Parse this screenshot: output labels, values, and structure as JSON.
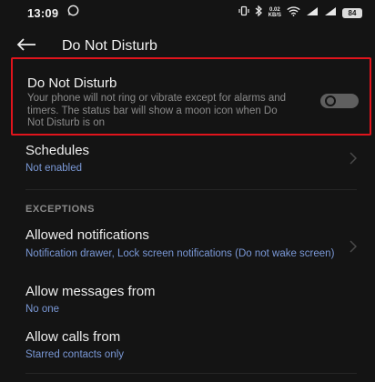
{
  "status_bar": {
    "time": "13:09",
    "speed_value": "0.02",
    "speed_unit": "KB/S",
    "battery": "84"
  },
  "app_bar": {
    "title": "Do Not Disturb"
  },
  "dnd": {
    "title": "Do Not Disturb",
    "description": "Your phone will not ring or vibrate except for alarms and timers. The status bar will show a moon icon when Do Not Disturb is on",
    "enabled": false,
    "highlight_color": "#e0141c"
  },
  "schedules": {
    "title": "Schedules",
    "subtitle": "Not enabled"
  },
  "exceptions": {
    "header": "EXCEPTIONS",
    "allowed_notifications": {
      "title": "Allowed notifications",
      "subtitle": "Notification drawer, Lock screen notifications (Do not wake screen)"
    },
    "allow_messages": {
      "title": "Allow messages from",
      "subtitle": "No one"
    },
    "allow_calls": {
      "title": "Allow calls from",
      "subtitle": "Starred contacts only"
    }
  },
  "colors": {
    "background": "#141414",
    "accent_text": "#7a98d6",
    "toggle_off": "#5f5f5f"
  }
}
